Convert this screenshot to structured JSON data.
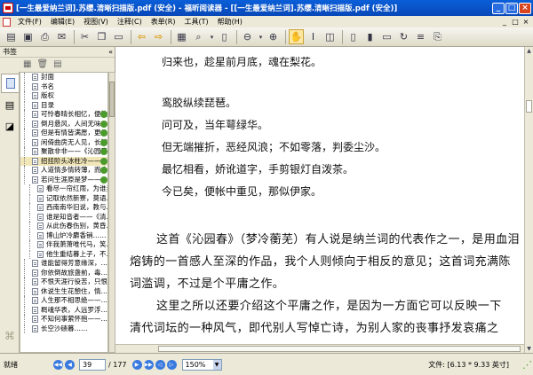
{
  "window": {
    "title": "[一生最爱纳兰词].苏缨.清晰扫描版.pdf (安全) - 福昕阅读器 - [[一生最爱纳兰词].苏缨.清晰扫描版.pdf (安全)]",
    "minimize": "_",
    "maximize": "□",
    "close": "×"
  },
  "menu": {
    "items": [
      "文件(F)",
      "编辑(E)",
      "视图(V)",
      "注释(C)",
      "表单(R)",
      "工具(T)",
      "帮助(H)"
    ],
    "mdi": [
      "_",
      "□",
      "×"
    ]
  },
  "sidebar": {
    "header": "书签",
    "collapse": "«",
    "tools": [
      "▦",
      "🗑",
      "▤"
    ],
    "bookmarks": [
      {
        "label": "封面",
        "level": 1,
        "selected": false
      },
      {
        "label": "书名",
        "level": 1,
        "selected": false
      },
      {
        "label": "版权",
        "level": 1,
        "selected": false
      },
      {
        "label": "目录",
        "level": 1,
        "selected": false
      },
      {
        "label": "可怜春晴长相忆，便教相思……",
        "level": 1,
        "selected": false
      },
      {
        "label": "倒月悬风，人间无味……",
        "level": 1,
        "selected": false
      },
      {
        "label": "但是有情皆满愿，更从……",
        "level": 1,
        "selected": false
      },
      {
        "label": "闲倚曲房无人见，长牌……",
        "level": 1,
        "selected": false
      },
      {
        "label": "聚散非非——《沁园春》",
        "level": 1,
        "selected": false
      },
      {
        "label": "招挂阶头冰柱冷——……",
        "level": 1,
        "selected": true
      },
      {
        "label": "人道情多情转薄，而今……",
        "level": 1,
        "selected": false
      },
      {
        "label": "若问生涯原是梦——……",
        "level": 1,
        "selected": false
      },
      {
        "label": "看尽一帘红雨，为谁亲……",
        "level": 2,
        "selected": false
      },
      {
        "label": "记取依然新寮，莫语……",
        "level": 2,
        "selected": false
      },
      {
        "label": "西南南华旧说，教与……",
        "level": 2,
        "selected": false
      },
      {
        "label": "谁是知音者——《清……",
        "level": 2,
        "selected": false
      },
      {
        "label": "从此伤春伤别，黄昏……",
        "level": 2,
        "selected": false
      },
      {
        "label": "博山炉冷麝香销……",
        "level": 2,
        "selected": false
      },
      {
        "label": "伴我萧萧唯代马，笑……",
        "level": 2,
        "selected": false
      },
      {
        "label": "他生重结暮上子，不……",
        "level": 2,
        "selected": false
      },
      {
        "label": "谁能留得芳意缘深，……",
        "level": 1,
        "selected": false
      },
      {
        "label": "你依倒故旅盏前，毒……",
        "level": 1,
        "selected": false
      },
      {
        "label": "不恨天涯行役苦，只恨……",
        "level": 1,
        "selected": false
      },
      {
        "label": "休说生生花憩住，情……",
        "level": 1,
        "selected": false
      },
      {
        "label": "人生那不相思绝——……",
        "level": 1,
        "selected": false
      },
      {
        "label": "羁魂华表，人远罗浮……",
        "level": 1,
        "selected": false
      },
      {
        "label": "不知何事萦怀抱——……",
        "level": 1,
        "selected": false
      },
      {
        "label": "长空沙碛暮……",
        "level": 1,
        "selected": false
      }
    ]
  },
  "toolbar": {
    "icons": [
      "📂",
      "💾",
      "🖨",
      "✉",
      "✂",
      "📋",
      "⇐",
      "⇒",
      "✋",
      "🔍",
      "▾",
      "⊖",
      "⊕",
      "▾",
      "⬜",
      "⬜",
      "⬜",
      "⬜",
      "⬜",
      "⬜"
    ]
  },
  "document": {
    "poem_lines": [
      "归来也，趁星前月底，魂在梨花。",
      "",
      "鸾胶纵续琵琶。",
      "问可及，当年萼绿华。",
      "但无端摧折，恶经风浪；不如零落，判委尘沙。",
      "最忆相看，娇讹道字，手剪银灯自泼茶。",
      "今已矣，便帐中重见，那似伊家。"
    ],
    "para_lines": [
      "这首《沁园春》（梦冷蘅芜）有人说是纳兰词的代表作之一，是用血泪",
      "熔铸的一首感人至深的作品，我个人则倾向于相反的意见；这首词充满陈",
      "词滥调，不过是个平庸之作。",
      "这里之所以还要介绍这个平庸之作，是因为一方面它可以反映一下",
      "清代词坛的一种风气，即代别人写悼亡诗，为别人家的丧事抒发哀痛之"
    ]
  },
  "status": {
    "ready": "就绪",
    "current_page": "39",
    "total_pages": "/ 177",
    "zoom": "150%",
    "file_info": "文件: [6.13 * 9.33 英寸]"
  }
}
